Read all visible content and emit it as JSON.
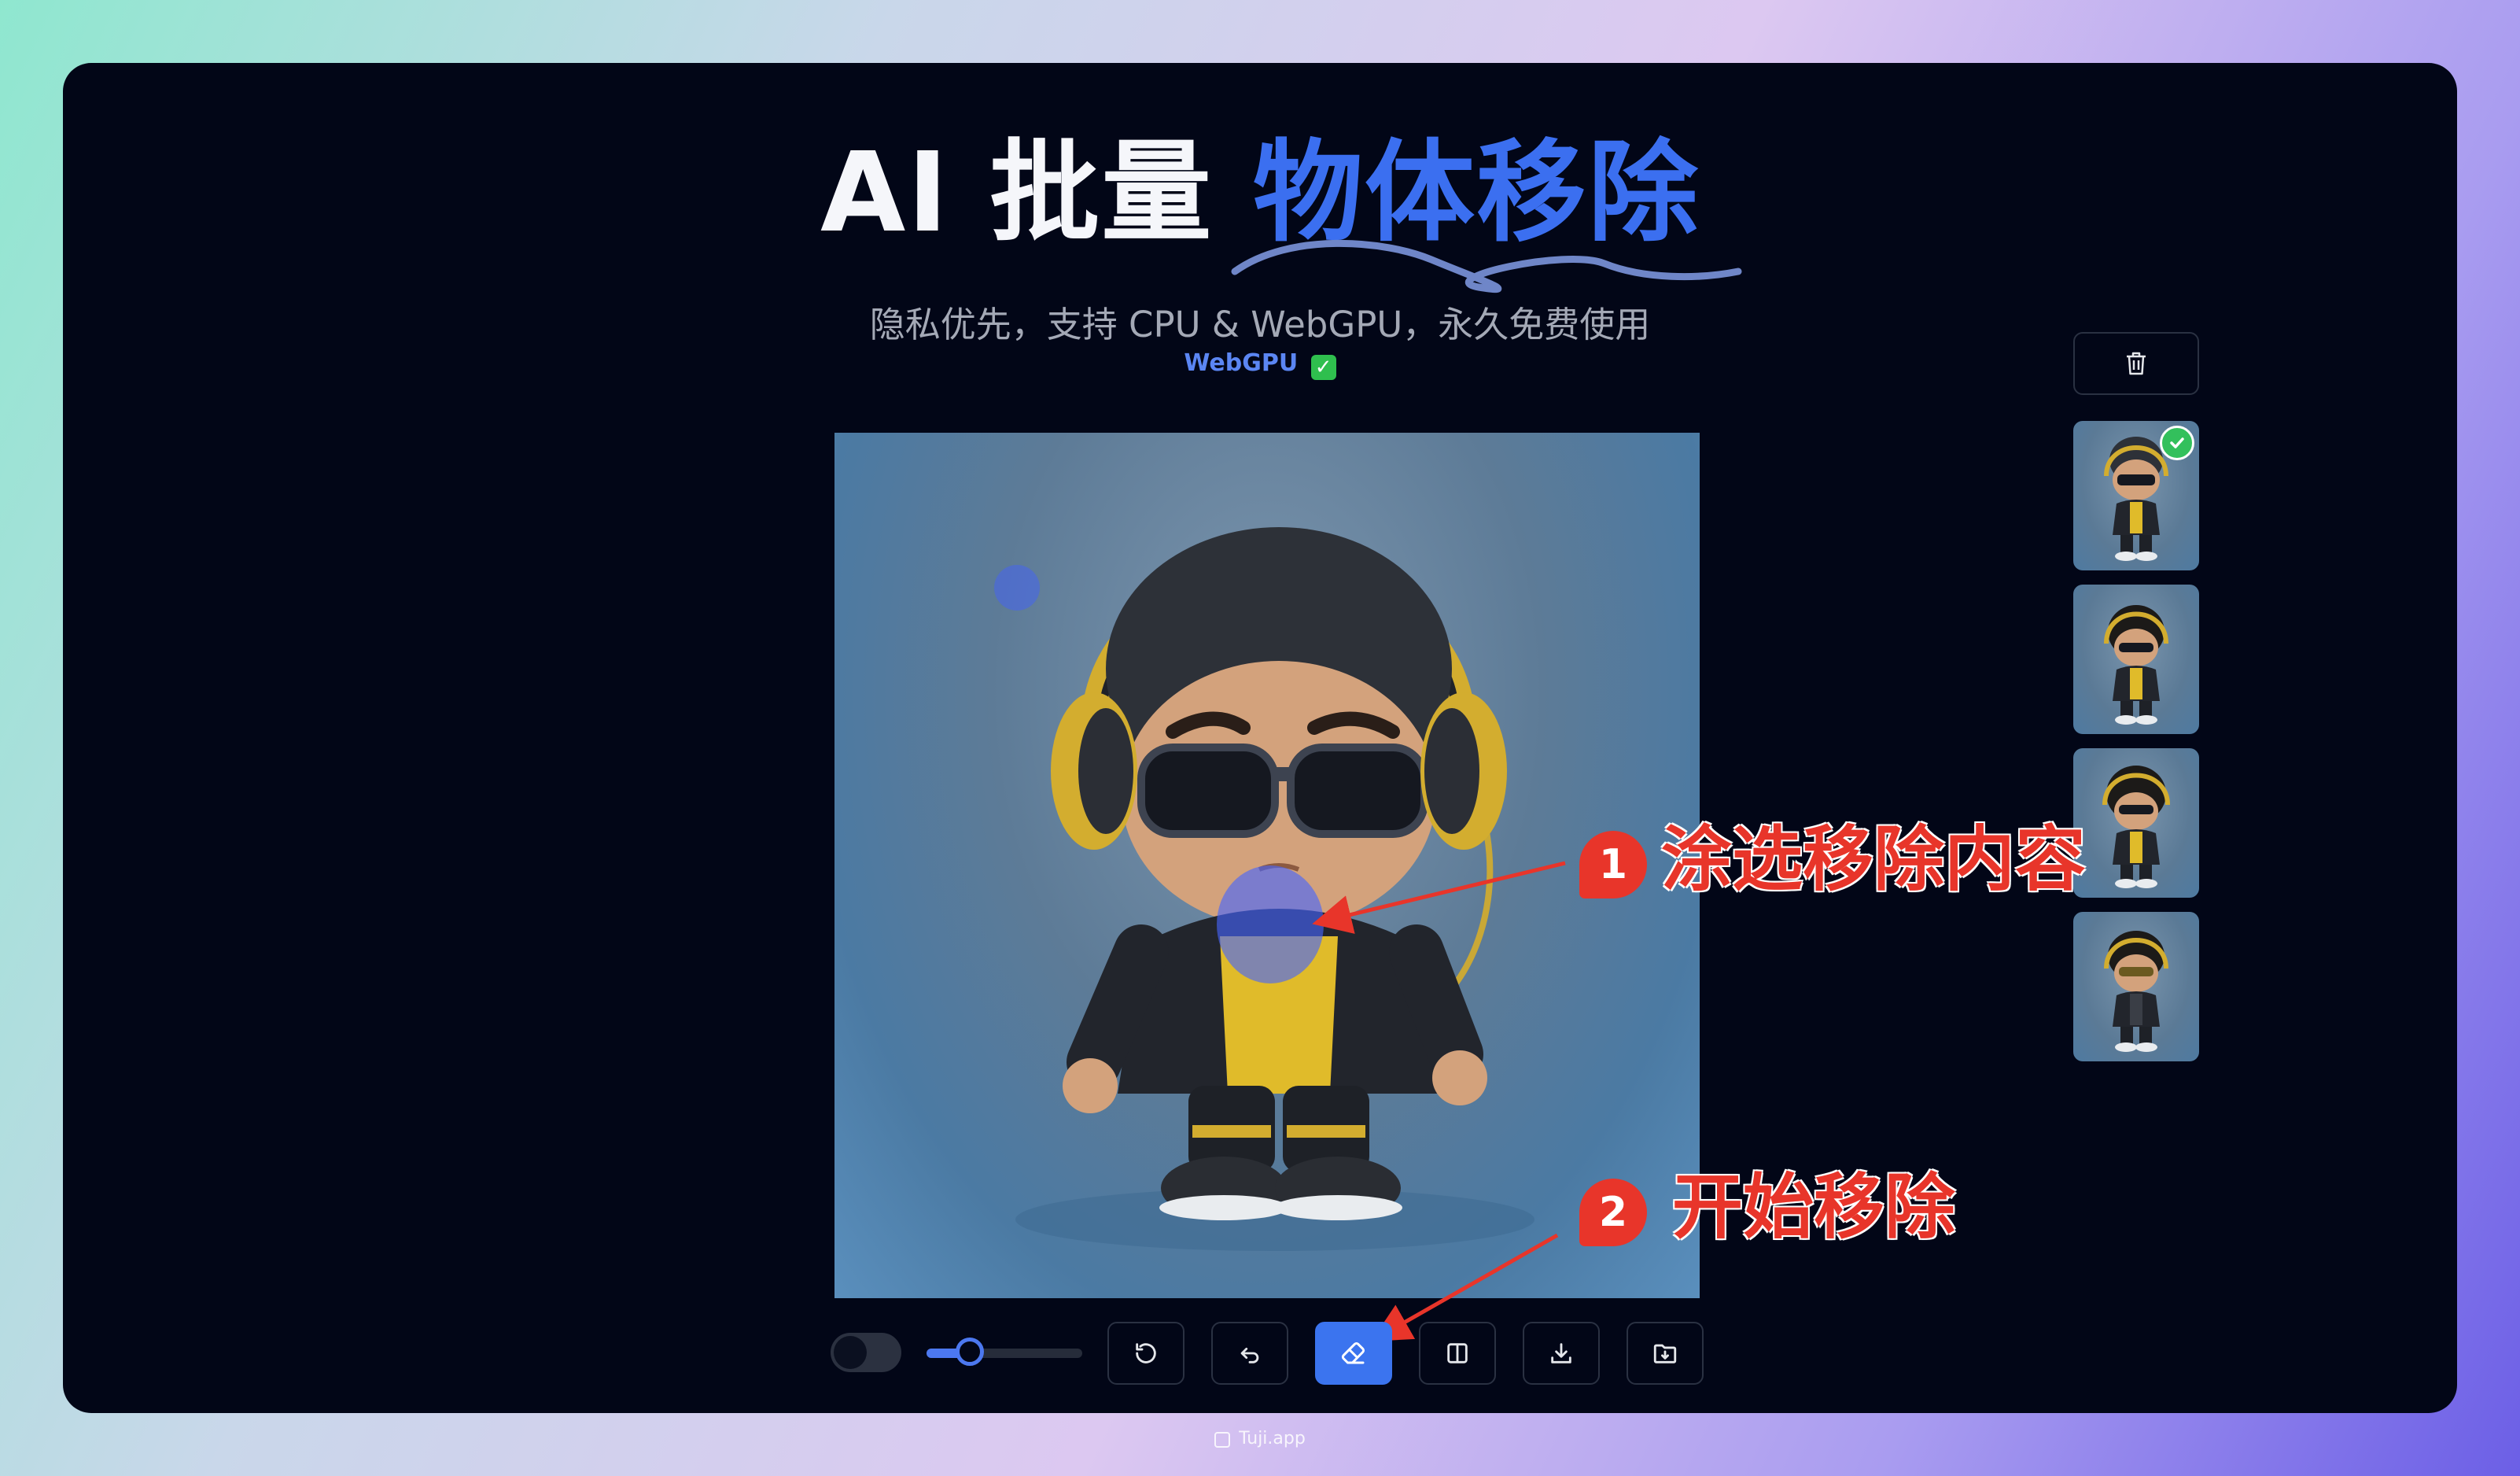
{
  "header": {
    "title_prefix": "AI 批量",
    "title_accent": "物体移除",
    "subtitle": "隐私优先，支持 CPU & WebGPU，永久免费使用",
    "status_label": "WebGPU",
    "status_icon": "checkmark-icon"
  },
  "annotations": [
    {
      "number": "1",
      "label": "涂选移除内容"
    },
    {
      "number": "2",
      "label": "开始移除"
    }
  ],
  "sidebar": {
    "delete_icon": "trash-icon",
    "thumbnails": [
      {
        "name": "thumbnail-1",
        "processed": true
      },
      {
        "name": "thumbnail-2",
        "processed": false
      },
      {
        "name": "thumbnail-3",
        "processed": false
      },
      {
        "name": "thumbnail-4",
        "processed": false
      }
    ]
  },
  "toolbar": {
    "toggle_on": false,
    "brush_size_fraction": 0.28,
    "buttons": [
      {
        "icon": "reset-icon"
      },
      {
        "icon": "undo-icon"
      },
      {
        "icon": "eraser-icon",
        "active": true
      },
      {
        "icon": "compare-icon"
      },
      {
        "icon": "download-icon"
      },
      {
        "icon": "save-folder-icon"
      }
    ]
  },
  "footer": {
    "brand": "Tuji.app"
  },
  "colors": {
    "accent": "#3b74ef",
    "annotation_red": "#e8352a",
    "panel_bg": "#020617"
  }
}
